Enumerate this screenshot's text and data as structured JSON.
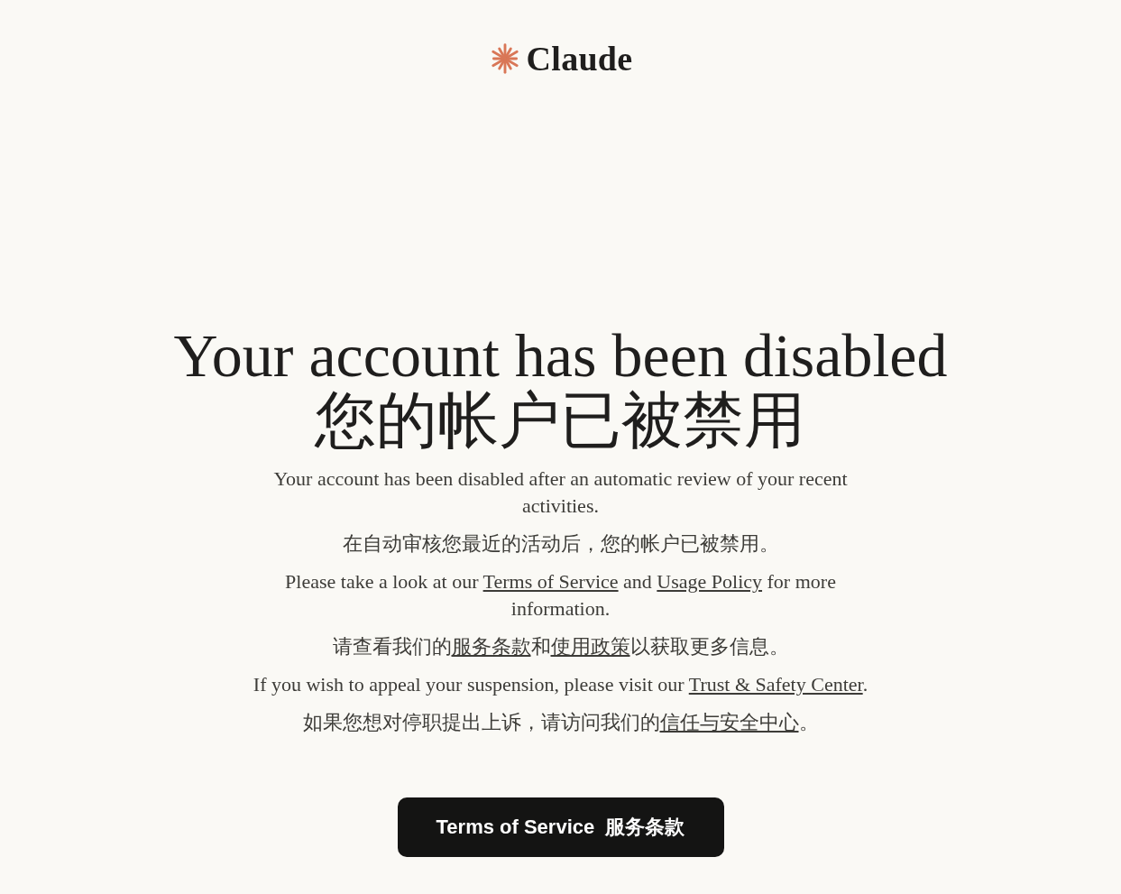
{
  "logo": {
    "text": "Claude"
  },
  "heading": {
    "lines": [
      "Your account has been disabled",
      "您的帐户已被禁用"
    ]
  },
  "paragraphs": [
    {
      "segments": [
        {
          "text": "Your account has been disabled after an automatic review of your recent activities.",
          "link": false
        }
      ]
    },
    {
      "segments": [
        {
          "text": "在自动审核您最近的活动后，您的帐户已被禁用。",
          "link": false
        }
      ]
    },
    {
      "segments": [
        {
          "text": "Please take a look at our ",
          "link": false
        },
        {
          "text": "Terms of Service",
          "link": true
        },
        {
          "text": " and ",
          "link": false
        },
        {
          "text": "Usage Policy",
          "link": true
        },
        {
          "text": " for more information.",
          "link": false
        }
      ]
    },
    {
      "segments": [
        {
          "text": "请查看我们的",
          "link": false
        },
        {
          "text": "服务条款",
          "link": true
        },
        {
          "text": "和",
          "link": false
        },
        {
          "text": "使用政策",
          "link": true
        },
        {
          "text": "以获取更多信息。",
          "link": false
        }
      ]
    },
    {
      "segments": [
        {
          "text": "If you wish to appeal your suspension, please visit our ",
          "link": false
        },
        {
          "text": "Trust & Safety Center",
          "link": true
        },
        {
          "text": ".",
          "link": false
        }
      ]
    },
    {
      "segments": [
        {
          "text": "如果您想对停职提出上诉，请访问我们的",
          "link": false
        },
        {
          "text": "信任与安全中心",
          "link": true
        },
        {
          "text": "。",
          "link": false
        }
      ]
    }
  ],
  "button": {
    "label": "Terms of Service  服务条款"
  }
}
